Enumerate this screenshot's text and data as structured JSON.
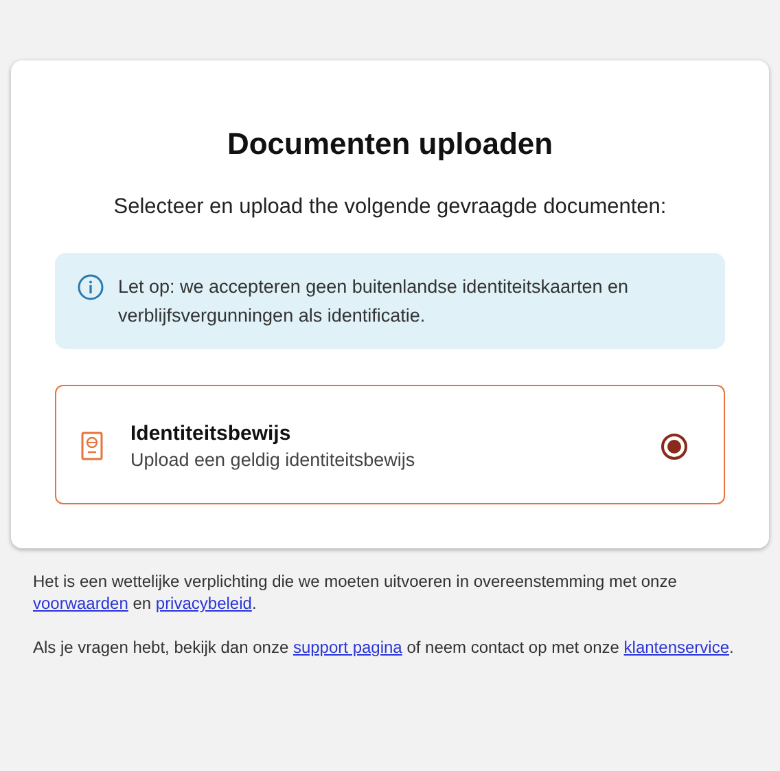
{
  "title": "Documenten uploaden",
  "subtitle": "Selecteer en upload the volgende gevraagde documenten:",
  "notice": {
    "text": "Let op: we accepteren geen buitenlandse identiteitskaarten en verblijfsvergunningen als identificatie."
  },
  "options": [
    {
      "title": "Identiteitsbewijs",
      "description": "Upload een geldig identiteitsbewijs",
      "selected": true
    }
  ],
  "footer": [
    {
      "segments": [
        {
          "kind": "text",
          "text": "Het is een wettelijke verplichting die we moeten uitvoeren in overeenstemming met onze "
        },
        {
          "kind": "link",
          "text": "voorwaarden"
        },
        {
          "kind": "text",
          "text": " en "
        },
        {
          "kind": "link",
          "text": "privacybeleid"
        },
        {
          "kind": "text",
          "text": "."
        }
      ]
    },
    {
      "segments": [
        {
          "kind": "text",
          "text": "Als je vragen hebt, bekijk dan onze "
        },
        {
          "kind": "link",
          "text": "support pagina"
        },
        {
          "kind": "text",
          "text": " of neem contact op met onze "
        },
        {
          "kind": "link",
          "text": "klantenservice"
        },
        {
          "kind": "text",
          "text": "."
        }
      ]
    }
  ]
}
